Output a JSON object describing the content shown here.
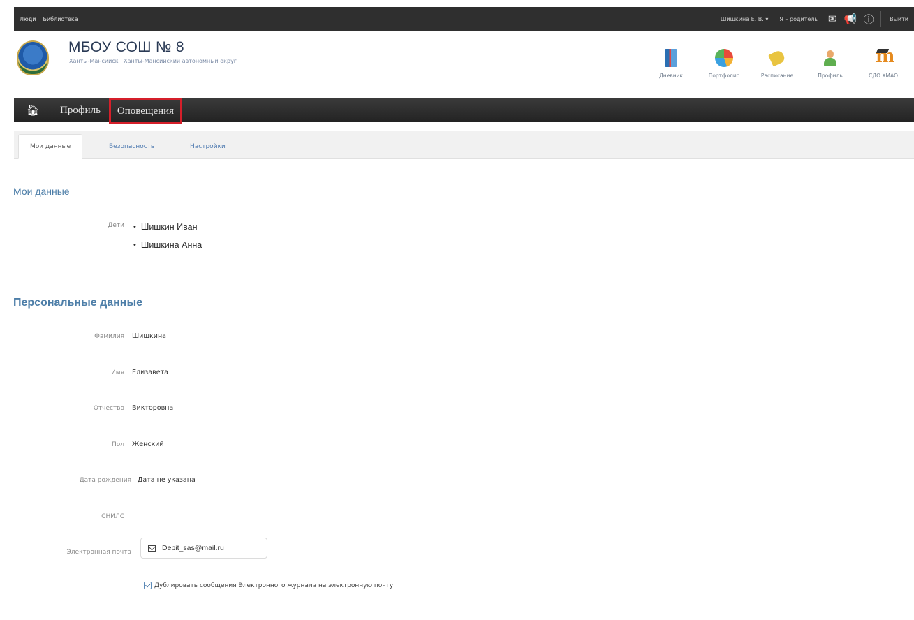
{
  "topbar": {
    "links": [
      "Люди",
      "Библиотека"
    ],
    "user": "Шишкина Е. В. ▾",
    "role": "Я – родитель",
    "logout": "Выйти"
  },
  "header": {
    "school_name": "МБОУ СОШ № 8",
    "school_location": "Ханты-Мансийск · Ханты-Мансийский автономный округ",
    "apps": [
      {
        "label": "Дневник",
        "icon": "diary-icon"
      },
      {
        "label": "Портфолио",
        "icon": "portfolio-icon"
      },
      {
        "label": "Расписание",
        "icon": "schedule-icon"
      },
      {
        "label": "Профиль",
        "icon": "profile-icon"
      },
      {
        "label": "СДО ХМАО",
        "icon": "sdo-icon"
      }
    ]
  },
  "nav": {
    "items": [
      "Профиль",
      "Оповещения"
    ]
  },
  "tabs": [
    "Мои данные",
    "Безопасность",
    "Настройки"
  ],
  "my_data": {
    "title": "Мои данные",
    "children_label": "Дети",
    "children": [
      "Шишкин Иван",
      "Шишкина Анна"
    ]
  },
  "personal": {
    "title": "Персональные данные",
    "fields": [
      {
        "label": "Фамилия",
        "value": "Шишкина"
      },
      {
        "label": "Имя",
        "value": "Елизавета"
      },
      {
        "label": "Отчество",
        "value": "Викторовна"
      },
      {
        "label": "Пол",
        "value": "Женский"
      },
      {
        "label": "Дата рождения",
        "value": "Дата не указана"
      },
      {
        "label": "СНИЛС",
        "value": ""
      },
      {
        "label": "Электронная почта",
        "value": "Depit_sas@mail.ru"
      }
    ],
    "duplicate_label": "Дублировать сообщения Электронного журнала на электронную почту"
  }
}
